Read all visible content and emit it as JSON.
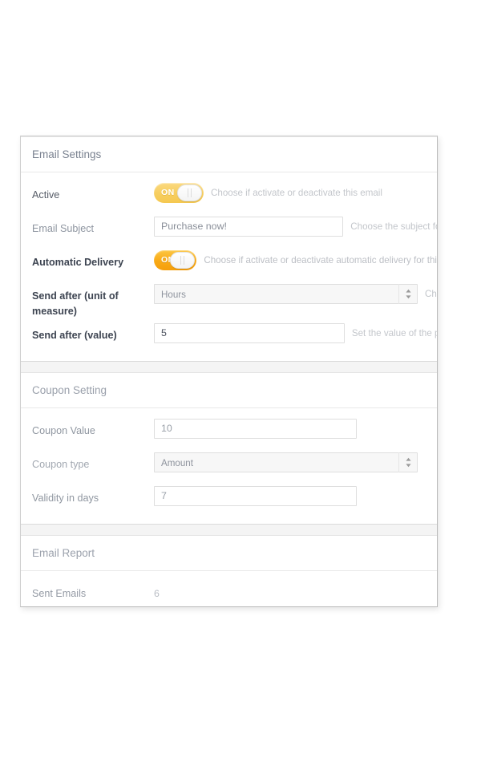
{
  "panels": [
    {
      "id": "email-settings",
      "header": "Email Settings",
      "rows": [
        {
          "label": "Active",
          "control": "toggle",
          "toggle_text": "ON",
          "help": "Choose if activate or deactivate this email"
        },
        {
          "label": "Email Subject",
          "control": "text",
          "value": "Purchase now!",
          "help": "Choose the subject for"
        },
        {
          "label": "Automatic Delivery",
          "control": "toggle",
          "toggle_text": "ON",
          "help": "Choose if activate or deactivate automatic delivery for this templat"
        },
        {
          "label": "Send after (unit of measure)",
          "control": "select",
          "value": "Hours",
          "help": "Cho"
        },
        {
          "label": "Send after (value)",
          "control": "text",
          "value": "5",
          "help": "Set the value of the pr"
        }
      ]
    },
    {
      "id": "coupon-setting",
      "header": "Coupon Setting",
      "rows": [
        {
          "label": "Coupon Value",
          "control": "text",
          "value": "10",
          "help": ""
        },
        {
          "label": "Coupon type",
          "control": "select",
          "value": "Amount",
          "help": ""
        },
        {
          "label": "Validity in days",
          "control": "text",
          "value": "7",
          "help": ""
        }
      ]
    },
    {
      "id": "email-report",
      "header": "Email Report",
      "rows": [
        {
          "label": "Sent Emails",
          "control": "readonly",
          "value": "6"
        }
      ]
    }
  ],
  "colors": {
    "toggle_on_faded": "#f7cf63",
    "toggle_on_vivid": "#f9ab17",
    "panel_background": "#ffffff",
    "page_background": "#ffffff",
    "header_text": "#7a8290",
    "help_text": "#c3c6cb",
    "border": "#dedede"
  },
  "icons": {
    "spinner": "up-down-spinner-icon"
  }
}
